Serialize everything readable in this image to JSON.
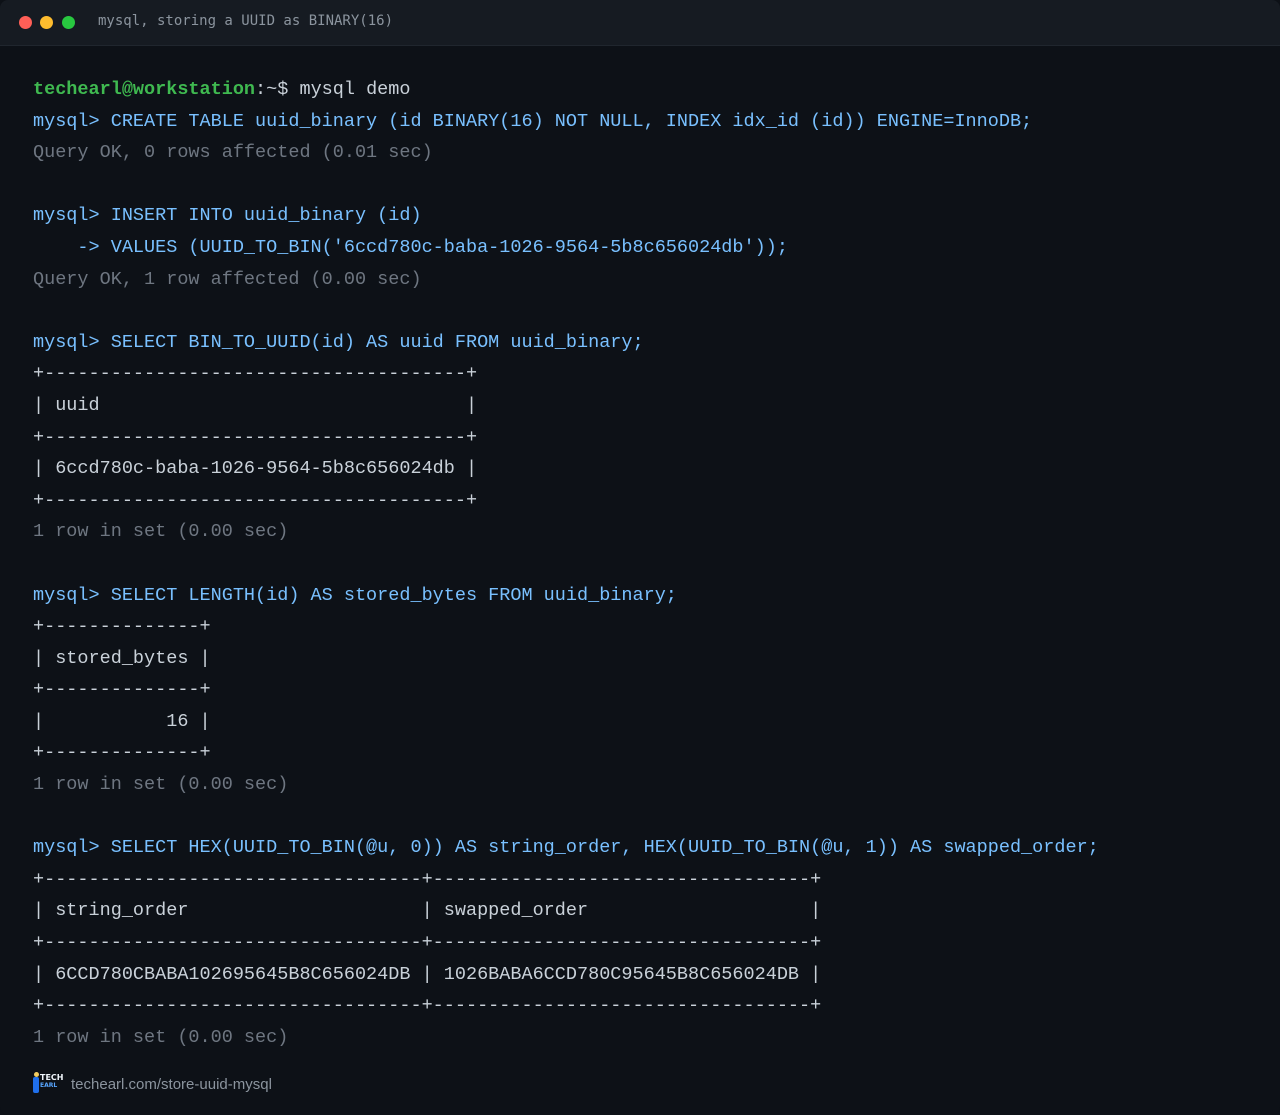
{
  "window": {
    "title": "mysql, storing a UUID as BINARY(16)"
  },
  "terminal": {
    "lines": [
      {
        "kind": "shell",
        "user": "techearl@workstation",
        "path": ":~$ ",
        "cmd": "mysql demo"
      },
      {
        "kind": "sql",
        "text": "mysql> CREATE TABLE uuid_binary (id BINARY(16) NOT NULL, INDEX idx_id (id)) ENGINE=InnoDB;"
      },
      {
        "kind": "muted",
        "text": "Query OK, 0 rows affected (0.01 sec)"
      },
      {
        "kind": "blank",
        "text": ""
      },
      {
        "kind": "sql",
        "text": "mysql> INSERT INTO uuid_binary (id)"
      },
      {
        "kind": "sql",
        "text": "    -> VALUES (UUID_TO_BIN('6ccd780c-baba-1026-9564-5b8c656024db'));"
      },
      {
        "kind": "muted",
        "text": "Query OK, 1 row affected (0.00 sec)"
      },
      {
        "kind": "blank",
        "text": ""
      },
      {
        "kind": "sql",
        "text": "mysql> SELECT BIN_TO_UUID(id) AS uuid FROM uuid_binary;"
      },
      {
        "kind": "table",
        "text": "+--------------------------------------+"
      },
      {
        "kind": "table",
        "text": "| uuid                                 |"
      },
      {
        "kind": "table",
        "text": "+--------------------------------------+"
      },
      {
        "kind": "table",
        "text": "| 6ccd780c-baba-1026-9564-5b8c656024db |"
      },
      {
        "kind": "table",
        "text": "+--------------------------------------+"
      },
      {
        "kind": "muted",
        "text": "1 row in set (0.00 sec)"
      },
      {
        "kind": "blank",
        "text": ""
      },
      {
        "kind": "sql",
        "text": "mysql> SELECT LENGTH(id) AS stored_bytes FROM uuid_binary;"
      },
      {
        "kind": "table",
        "text": "+--------------+"
      },
      {
        "kind": "table",
        "text": "| stored_bytes |"
      },
      {
        "kind": "table",
        "text": "+--------------+"
      },
      {
        "kind": "table",
        "text": "|           16 |"
      },
      {
        "kind": "table",
        "text": "+--------------+"
      },
      {
        "kind": "muted",
        "text": "1 row in set (0.00 sec)"
      },
      {
        "kind": "blank",
        "text": ""
      },
      {
        "kind": "sql",
        "text": "mysql> SELECT HEX(UUID_TO_BIN(@u, 0)) AS string_order, HEX(UUID_TO_BIN(@u, 1)) AS swapped_order;"
      },
      {
        "kind": "table",
        "text": "+----------------------------------+----------------------------------+"
      },
      {
        "kind": "table",
        "text": "| string_order                     | swapped_order                    |"
      },
      {
        "kind": "table",
        "text": "+----------------------------------+----------------------------------+"
      },
      {
        "kind": "table",
        "text": "| 6CCD780CBABA102695645B8C656024DB | 1026BABA6CCD780C95645B8C656024DB |"
      },
      {
        "kind": "table",
        "text": "+----------------------------------+----------------------------------+"
      },
      {
        "kind": "muted",
        "text": "1 row in set (0.00 sec)"
      }
    ]
  },
  "footer": {
    "logo_top": "TECH",
    "logo_bottom": "EARL",
    "url": "techearl.com/store-uuid-mysql"
  },
  "colors": {
    "background": "#0d1117",
    "sql": "#79c0ff",
    "prompt_user": "#3fb950",
    "muted": "#6e7681",
    "text": "#c9d1d9"
  }
}
